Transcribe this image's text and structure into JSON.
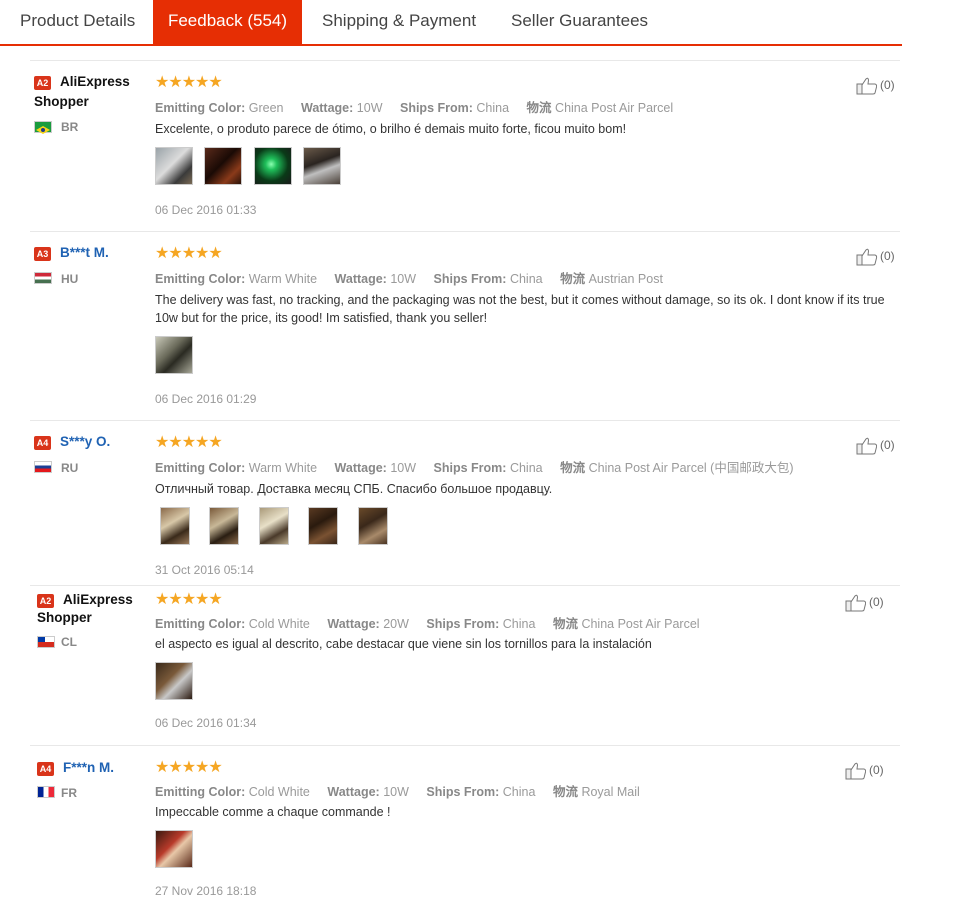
{
  "tabs": [
    {
      "label": "Product Details",
      "active": false
    },
    {
      "label": "Feedback (554)",
      "active": true
    },
    {
      "label": "Shipping & Payment",
      "active": false
    },
    {
      "label": "Seller Guarantees",
      "active": false
    }
  ],
  "colors": {
    "accent": "#e62e04",
    "stars": "#f5a623",
    "name_link": "#1f62b3",
    "badge": "#d9341a"
  },
  "labels": {
    "color": "Emitting Color:",
    "wattage": "Wattage:",
    "ships": "Ships From:",
    "logistics": "物流"
  },
  "reviews": [
    {
      "badge": "A2",
      "name_line1": "AliExpress",
      "name_line2": "Shopper",
      "country": "BR",
      "flag": "brazil",
      "stars": "★★★★★",
      "rating": 5,
      "color": "Green",
      "wattage": "10W",
      "ships": "China",
      "logistics": "China Post Air Parcel",
      "text": "Excelente, o produto parece de ótimo, o brilho é demais muito forte, ficou muito bom!",
      "photo_count": 4,
      "date": "06 Dec 2016 01:33",
      "likes": "(0)"
    },
    {
      "badge": "A3",
      "name_line1": "B***t M.",
      "country": "HU",
      "flag": "hungary",
      "stars": "★★★★★",
      "rating": 5,
      "color": "Warm White",
      "wattage": "10W",
      "ships": "China",
      "logistics": "Austrian Post",
      "text": "The delivery was fast, no tracking, and the packaging was not the best, but it comes without damage, so its ok. I dont know if its true 10w but for the price, its good! Im satisfied, thank you seller!",
      "photo_count": 1,
      "date": "06 Dec 2016 01:29",
      "likes": "(0)"
    },
    {
      "badge": "A4",
      "name_line1": "S***y O.",
      "country": "RU",
      "flag": "russia",
      "stars": "★★★★★",
      "rating": 5,
      "color": "Warm White",
      "wattage": "10W",
      "ships": "China",
      "logistics": "China Post Air Parcel (中国邮政大包)",
      "text": "Отличный товар. Доставка месяц СПБ. Спасибо большое продавцу.",
      "photo_count": 5,
      "date": "31 Oct 2016 05:14",
      "likes": "(0)"
    },
    {
      "badge": "A2",
      "name_line1": "AliExpress",
      "name_line2": "Shopper",
      "country": "CL",
      "flag": "chile",
      "stars": "★★★★★",
      "rating": 5,
      "color": "Cold White",
      "wattage": "20W",
      "ships": "China",
      "logistics": "China Post Air Parcel",
      "text": "el aspecto es igual al descrito, cabe destacar que viene sin los tornillos para la instalación",
      "photo_count": 1,
      "date": "06 Dec 2016 01:34",
      "likes": "(0)"
    },
    {
      "badge": "A4",
      "name_line1": "F***n M.",
      "country": "FR",
      "flag": "france",
      "stars": "★★★★★",
      "rating": 5,
      "color": "Cold White",
      "wattage": "10W",
      "ships": "China",
      "logistics": "Royal Mail",
      "text": "Impeccable comme a chaque commande !",
      "photo_count": 1,
      "date": "27 Nov 2016 18:18",
      "likes": "(0)"
    }
  ]
}
